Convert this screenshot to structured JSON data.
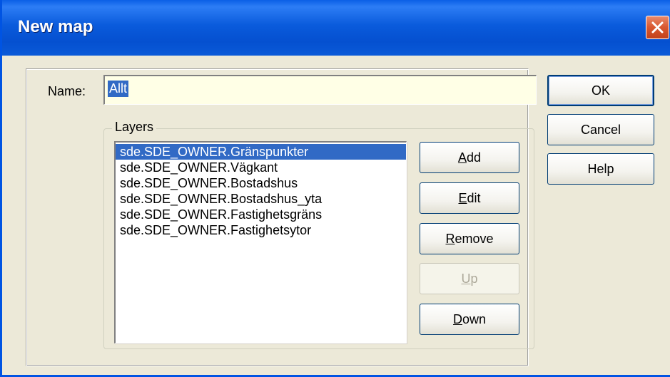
{
  "window": {
    "title": "New map",
    "close_icon": "close-icon"
  },
  "form": {
    "name_label": "Name:",
    "name_value": "Allt",
    "layers_legend": "Layers"
  },
  "layers": [
    {
      "label": "sde.SDE_OWNER.Gränspunkter",
      "selected": true
    },
    {
      "label": "sde.SDE_OWNER.Vägkant",
      "selected": false
    },
    {
      "label": "sde.SDE_OWNER.Bostadshus",
      "selected": false
    },
    {
      "label": "sde.SDE_OWNER.Bostadshus_yta",
      "selected": false
    },
    {
      "label": "sde.SDE_OWNER.Fastighetsgräns",
      "selected": false
    },
    {
      "label": "sde.SDE_OWNER.Fastighetsytor",
      "selected": false
    }
  ],
  "layer_buttons": {
    "add": {
      "mnemonic": "A",
      "rest": "dd"
    },
    "edit": {
      "mnemonic": "E",
      "rest": "dit"
    },
    "remove": {
      "mnemonic": "R",
      "rest": "emove"
    },
    "up": {
      "mnemonic": "U",
      "rest": "p",
      "disabled": true
    },
    "down": {
      "mnemonic": "D",
      "rest": "own"
    }
  },
  "dialog_buttons": {
    "ok": "OK",
    "cancel": "Cancel",
    "help": "Help"
  },
  "colors": {
    "titlebar": "#0a5bdc",
    "selection": "#316ac5",
    "face": "#ece9d8"
  }
}
